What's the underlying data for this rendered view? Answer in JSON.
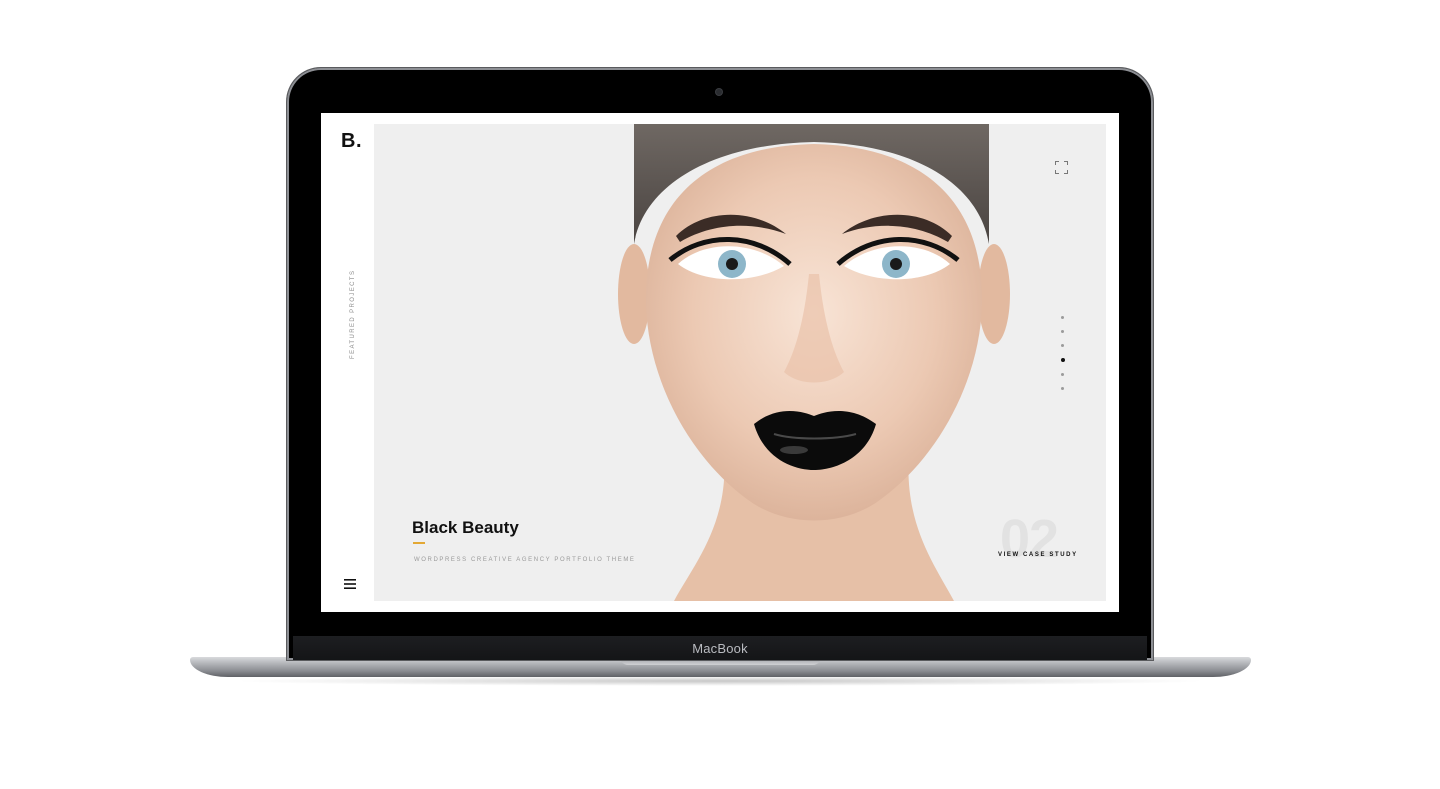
{
  "device": {
    "brand_label": "MacBook"
  },
  "sidebar": {
    "logo": "B.",
    "section_label": "Featured Projects"
  },
  "slide": {
    "title": "Black Beauty",
    "subtitle": "Wordpress Creative Agency Portfolio Theme",
    "number": "02",
    "cta_label": "View Case Study",
    "accent_color": "#e3a834",
    "pagination": {
      "total": 6,
      "active_index": 4
    }
  }
}
